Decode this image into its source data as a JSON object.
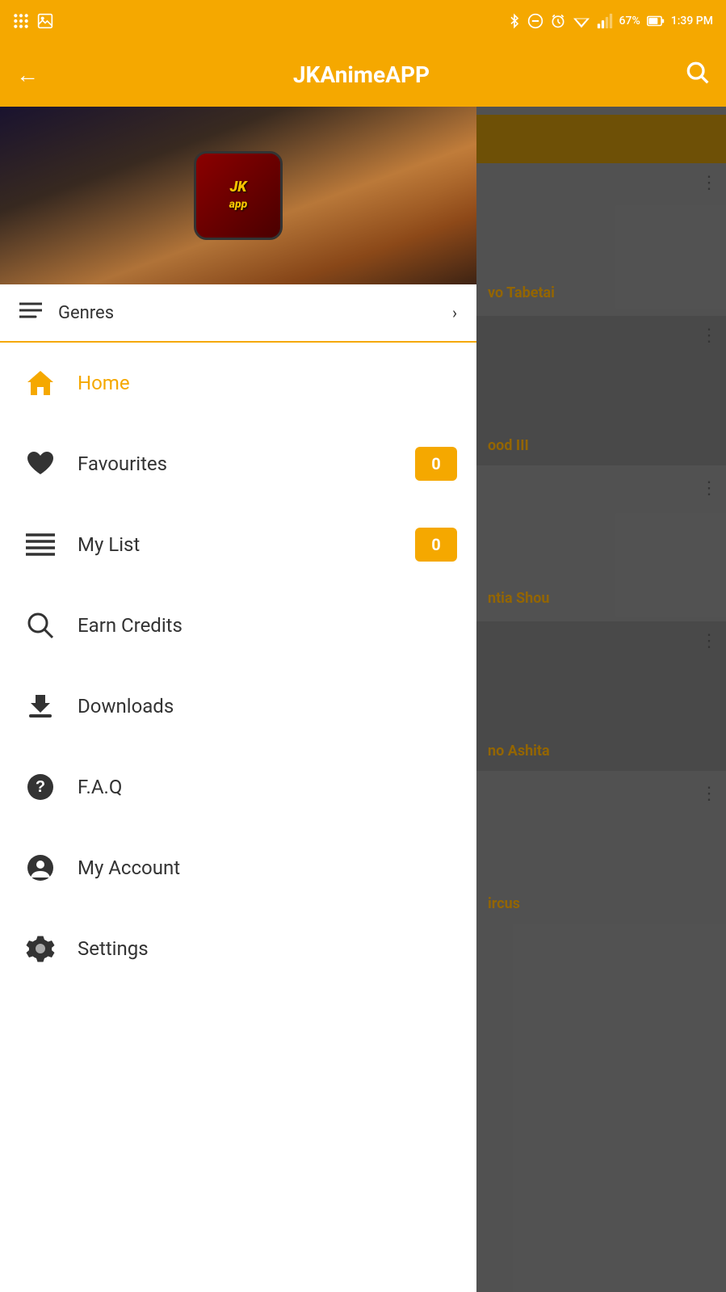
{
  "statusBar": {
    "time": "1:39 PM",
    "battery": "67%",
    "signal": "▲"
  },
  "topBar": {
    "title": "JKAnimeAPP",
    "backLabel": "←",
    "searchLabel": "🔍"
  },
  "sidebar": {
    "logoText": "JK\napp",
    "genres": {
      "label": "Genres",
      "arrow": "›"
    },
    "navItems": [
      {
        "id": "home",
        "label": "Home",
        "icon": "home",
        "active": true,
        "badge": null
      },
      {
        "id": "favourites",
        "label": "Favourites",
        "icon": "heart",
        "active": false,
        "badge": "0"
      },
      {
        "id": "mylist",
        "label": "My List",
        "icon": "list",
        "active": false,
        "badge": "0"
      },
      {
        "id": "earncredits",
        "label": "Earn Credits",
        "icon": "search",
        "active": false,
        "badge": null
      },
      {
        "id": "downloads",
        "label": "Downloads",
        "icon": "download",
        "active": false,
        "badge": null
      },
      {
        "id": "faq",
        "label": "F.A.Q",
        "icon": "question",
        "active": false,
        "badge": null
      },
      {
        "id": "myaccount",
        "label": "My Account",
        "icon": "person",
        "active": false,
        "badge": null
      },
      {
        "id": "settings",
        "label": "Settings",
        "icon": "gear",
        "active": false,
        "badge": null
      }
    ]
  },
  "rightContent": {
    "items": [
      {
        "title": "vo Tabetai",
        "id": "item1"
      },
      {
        "title": "ood III",
        "id": "item2"
      },
      {
        "title": "ntia Shou",
        "id": "item3"
      },
      {
        "title": "no Ashita",
        "id": "item4"
      },
      {
        "title": "ircus",
        "id": "item5"
      }
    ]
  },
  "colors": {
    "accent": "#F5A800",
    "dark": "#333333",
    "white": "#FFFFFF"
  }
}
